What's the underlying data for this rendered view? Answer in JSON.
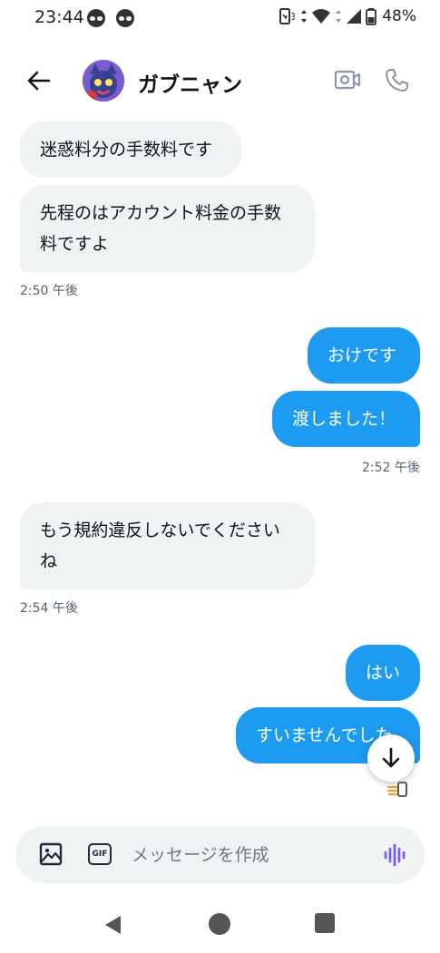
{
  "status_bar": {
    "time": "23:44",
    "battery": "48%"
  },
  "header": {
    "name": "ガブニャン"
  },
  "messages": [
    {
      "direction": "in",
      "text": "迷惑料分の手数料です"
    },
    {
      "direction": "in",
      "lines": [
        "先程のはアカウント料金の手数",
        "料ですよ"
      ]
    },
    {
      "direction": "out",
      "text": "おけです"
    },
    {
      "direction": "out",
      "text": "渡しました！"
    },
    {
      "direction": "in",
      "lines": [
        "もう規約違反しないでください",
        "ね"
      ]
    },
    {
      "direction": "out",
      "text": "はい"
    },
    {
      "direction": "out",
      "text": "すいませんでした"
    }
  ],
  "timestamps": {
    "t1": "2:50 午後",
    "t2": "2:52 午後",
    "t3": "2:54 午後"
  },
  "composer": {
    "placeholder": "メッセージを作成",
    "gif_label": "GIF"
  },
  "colors": {
    "accent": "#1d9bf0",
    "incoming_bubble": "#eff3f4",
    "voice_accent": "#7856ff"
  }
}
